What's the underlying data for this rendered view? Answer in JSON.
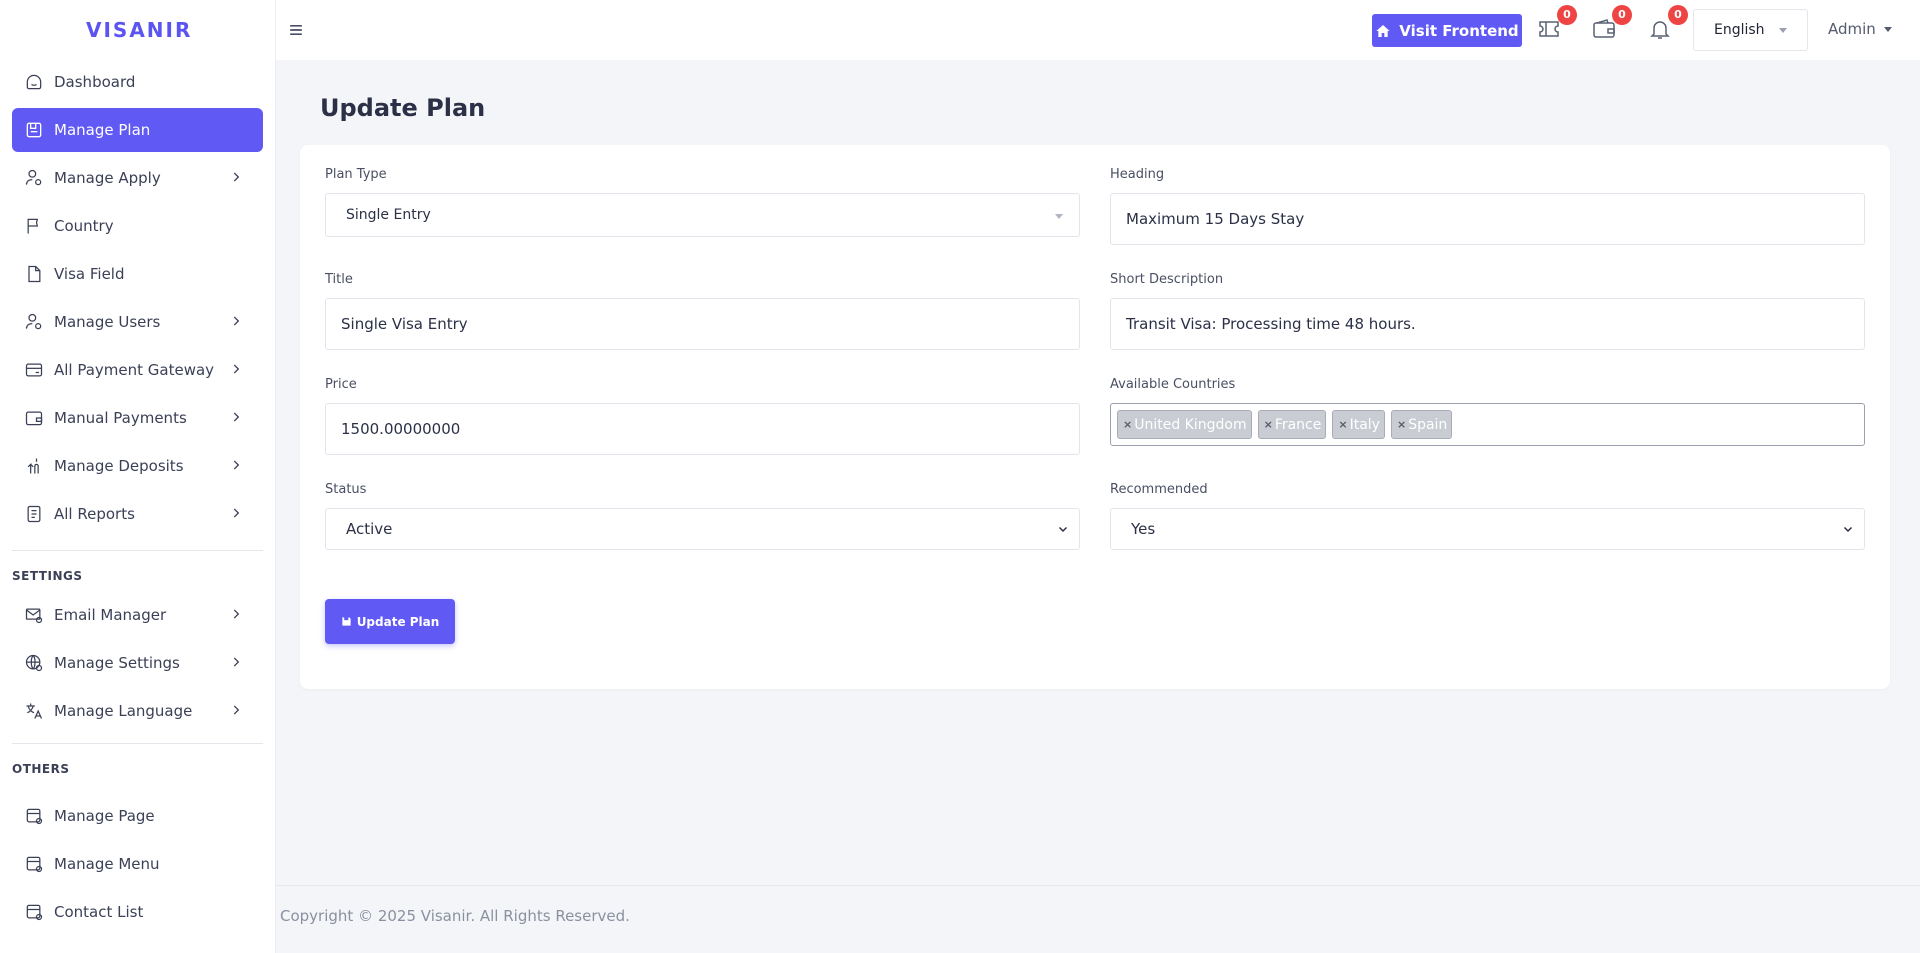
{
  "brand": "VISANIR",
  "sidebar": {
    "items": [
      {
        "label": "Dashboard",
        "icon": "dashboard-icon"
      },
      {
        "label": "Manage Plan",
        "icon": "plan-icon",
        "active": true
      },
      {
        "label": "Manage Apply",
        "icon": "user-gear-icon"
      },
      {
        "label": "Country",
        "icon": "flag-icon"
      },
      {
        "label": "Visa Field",
        "icon": "file-icon"
      },
      {
        "label": "Manage Users",
        "icon": "user-gear-icon"
      },
      {
        "label": "All Payment Gateway",
        "icon": "card-icon"
      },
      {
        "label": "Manual Payments",
        "icon": "wallet-icon"
      },
      {
        "label": "Manage Deposits",
        "icon": "deposit-icon"
      },
      {
        "label": "All Reports",
        "icon": "report-icon"
      }
    ],
    "settings_heading": "SETTINGS",
    "settings_items": [
      {
        "label": "Email Manager",
        "icon": "mail-gear-icon"
      },
      {
        "label": "Manage Settings",
        "icon": "globe-gear-icon"
      },
      {
        "label": "Manage Language",
        "icon": "translate-icon"
      }
    ],
    "others_heading": "OTHERS",
    "others_items": [
      {
        "label": "Manage Page",
        "icon": "page-gear-icon"
      },
      {
        "label": "Manage Menu",
        "icon": "page-gear-icon"
      },
      {
        "label": "Contact List",
        "icon": "page-gear-icon"
      }
    ]
  },
  "topbar": {
    "visit_frontend": "Visit Frontend",
    "ticket_count": "0",
    "wallet_count": "0",
    "notification_count": "0",
    "language": "English",
    "user": "Admin"
  },
  "page": {
    "title": "Update Plan"
  },
  "form": {
    "plan_type_label": "Plan Type",
    "plan_type_value": "Single Entry",
    "heading_label": "Heading",
    "heading_value": "Maximum 15 Days Stay",
    "title_label": "Title",
    "title_value": "Single Visa Entry",
    "short_desc_label": "Short Description",
    "short_desc_value": "Transit Visa: Processing time 48 hours.",
    "price_label": "Price",
    "price_value": "1500.00000000",
    "countries_label": "Available Countries",
    "countries": [
      "United Kingdom",
      "France",
      "Italy",
      "Spain"
    ],
    "status_label": "Status",
    "status_value": "Active",
    "recommended_label": "Recommended",
    "recommended_value": "Yes",
    "submit_label": "Update Plan"
  },
  "footer": {
    "copyright": "Copyright © 2025 Visanir. All Rights Reserved."
  },
  "colors": {
    "accent": "#6059f4",
    "badge": "#ef4444",
    "background": "#f3f5f8"
  }
}
